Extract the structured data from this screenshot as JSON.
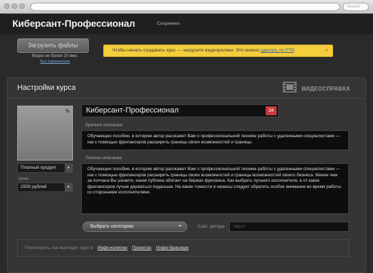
{
  "browser": {
    "search_placeholder": "Search"
  },
  "header": {
    "title": "Киберсант-Профессионал",
    "status": "Сохранено"
  },
  "upload": {
    "button_label": "Загрузить файлы",
    "note": "Видео не более 20 мин.",
    "limits_link": "Все ограничения"
  },
  "notice": {
    "text": "Чтобы начать создавать курс — загрузите видеоролики. Это можно ",
    "link": "сделать по FTP",
    "tail": ".",
    "close": "×"
  },
  "settings": {
    "title": "Настройки курса",
    "video_help": "ВИДЕОСПРАВКА",
    "cover_edit_icon": "pencil-icon",
    "product_type": "Платный продукт",
    "price_label": "Цена",
    "price_value": "2500 рублей",
    "course_title": "Киберсант-Профессионал",
    "char_count": "34",
    "short_label": "Краткое описание",
    "short_text": "Обучающее пособие, в котором автор расскажет Вам о профессиональной технике работы с удаленными специалистами — как с помощью фрилансеров расширить границы своих возможностей и границы.",
    "full_label": "Полное описание",
    "full_text": "Обучающее пособие, в котором автор расскажет Вам о профессиональной технике работы с удаленными специалистами — как с помощью фрилансеров расширить границы своих возможностей и границы возможностей своего бизнеса. Менее чем за полчаса Вы узнаете, какая публика обитает на биржах фриланса. Как выбрать лучшего исполнителя, а от каких фрилансеров лучше держаться подальше. На какие тонкости и нюансы следует обратить особое внимание во время работы со сторонними исполнителями.",
    "category_label": "Выбрать категорию",
    "author_site_label": "Сайт автора",
    "author_site_placeholder": "http://"
  },
  "preview": {
    "text": "Посмотреть, как выглядит курс в",
    "links": [
      "Инфо-копилке",
      "Проектах",
      "Инфо-браузере"
    ]
  },
  "colors": {
    "accent_yellow": "#f4cd3c",
    "counter_red": "#c73a3a",
    "link_blue": "#2b5fa8"
  }
}
